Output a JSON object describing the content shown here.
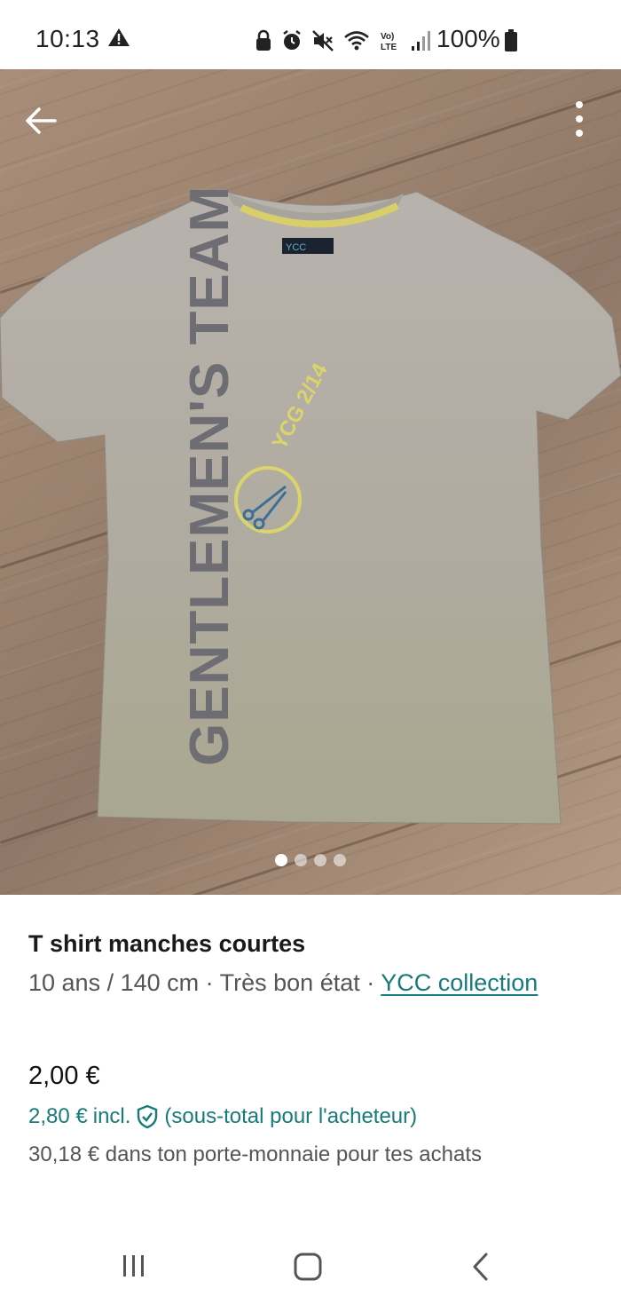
{
  "status_bar": {
    "time": "10:13",
    "battery": "100%"
  },
  "photo": {
    "slides": 4,
    "active_slide": 1,
    "print_text": "GENTLEMEN'S TEAM",
    "badge_text": "YCG 2/14",
    "label_text": "YCC"
  },
  "listing": {
    "title": "T shirt manches courtes",
    "size": "10 ans / 140 cm",
    "separator": " · ",
    "condition": "Très bon état",
    "brand": "YCC collection",
    "price": "2,00 €",
    "buyer_price": "2,80 €",
    "buyer_incl": "incl.",
    "buyer_note": "(sous-total pour l'acheteur)",
    "wallet_note": "30,18 € dans ton porte-monnaie pour tes achats"
  },
  "colors": {
    "accent": "#187a7a"
  },
  "icons": {
    "back": "arrow-left-icon",
    "menu": "more-vertical-icon",
    "protection": "shield-check-icon"
  }
}
